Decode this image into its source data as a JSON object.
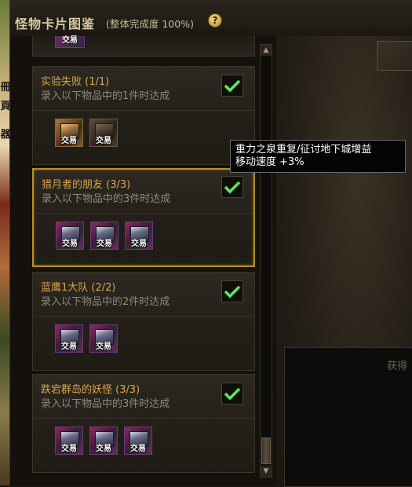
{
  "window": {
    "title": "怪物卡片图鉴",
    "subtitle": "(整体完成度 100%)",
    "help_icon": "question-icon"
  },
  "background": {
    "glyphs": [
      "冊",
      "頁",
      "器"
    ]
  },
  "partial_top": {
    "item_tag": "交易"
  },
  "cards": [
    {
      "title": "实验失败 (1/1)",
      "description": "录入以下物品中的1件时达成",
      "completed": true,
      "items": [
        {
          "tag": "交易",
          "style": "brown"
        },
        {
          "tag": "交易",
          "style": "dark"
        }
      ]
    },
    {
      "title": "猎月者的朋友 (3/3)",
      "description": "录入以下物品中的3件时达成",
      "completed": true,
      "selected": true,
      "items": [
        {
          "tag": "交易",
          "style": "purple"
        },
        {
          "tag": "交易",
          "style": "purple"
        },
        {
          "tag": "交易",
          "style": "purple"
        }
      ]
    },
    {
      "title": "蓝鹰1大队 (2/2)",
      "description": "录入以下物品中的2件时达成",
      "completed": true,
      "items": [
        {
          "tag": "交易",
          "style": "purple"
        },
        {
          "tag": "交易",
          "style": "purple"
        }
      ]
    },
    {
      "title": "跌宕群岛的妖怪 (3/3)",
      "description": "录入以下物品中的3件时达成",
      "completed": true,
      "items": [
        {
          "tag": "交易",
          "style": "purple"
        },
        {
          "tag": "交易",
          "style": "purple"
        },
        {
          "tag": "交易",
          "style": "purple"
        }
      ]
    }
  ],
  "tooltip": {
    "line1": "重力之泉重复/征讨地下城增益",
    "line2": "移动速度 +3%"
  },
  "right_panel": {
    "label": "获得"
  },
  "scrollbar": {
    "up_icon": "arrow-up-icon",
    "down_icon": "arrow-down-icon",
    "position": 0.92
  },
  "colors": {
    "title_gold": "#d9a64a",
    "desc_gray": "#8f8a7c",
    "selected_border": "#b8902a",
    "check_green": "#3ec63e"
  }
}
